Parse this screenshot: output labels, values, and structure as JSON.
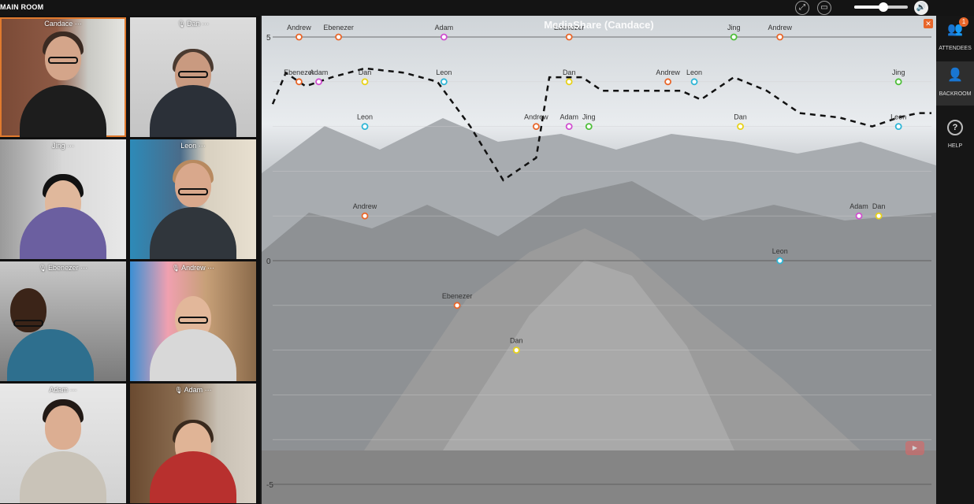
{
  "topbar": {
    "room_label": "MAIN ROOM",
    "volume_level": 0.55
  },
  "participants": [
    {
      "name": "Candace",
      "mic": false,
      "active": true
    },
    {
      "name": "Dan",
      "mic": true,
      "active": false
    },
    {
      "name": "Jing",
      "mic": false,
      "active": false
    },
    {
      "name": "Leon",
      "mic": false,
      "active": false
    },
    {
      "name": "Ebenezer",
      "mic": true,
      "active": false
    },
    {
      "name": "Andrew",
      "mic": true,
      "active": false
    },
    {
      "name": "Adam",
      "mic": false,
      "active": false
    },
    {
      "name": "Adam",
      "mic": true,
      "active": false
    }
  ],
  "tile_more": "···",
  "share": {
    "title": "MediaShare (Candace)"
  },
  "rightbar": {
    "attendees_label": "ATTENDEES",
    "attendees_badge": "1",
    "backroom_label": "BACKROOM",
    "help_label": "HELP"
  },
  "chart_data": {
    "type": "scatter",
    "ylim": [
      -5,
      5
    ],
    "y_ticks": [
      "5",
      "0",
      "-5"
    ],
    "grid": true,
    "colors": {
      "Ebenezer": "#e8662a",
      "Adam": "#d04fd0",
      "Dan": "#e8d21a",
      "Leon": "#2fb6d6",
      "Andrew": "#e8662a",
      "Jing": "#4fbf3a",
      "Candace": "#e8d21a"
    },
    "points": [
      {
        "label": "Andrew",
        "x": 0.04,
        "y": 5.0
      },
      {
        "label": "Ebenezer",
        "x": 0.1,
        "y": 5.0
      },
      {
        "label": "Adam",
        "x": 0.26,
        "y": 5.0
      },
      {
        "label": "Ebenezer",
        "x": 0.45,
        "y": 5.0
      },
      {
        "label": "Jing",
        "x": 0.7,
        "y": 5.0
      },
      {
        "label": "Andrew",
        "x": 0.77,
        "y": 5.0
      },
      {
        "label": "Ebenezer",
        "x": 0.04,
        "y": 4.0
      },
      {
        "label": "Adam",
        "x": 0.07,
        "y": 4.0
      },
      {
        "label": "Dan",
        "x": 0.14,
        "y": 4.0
      },
      {
        "label": "Leon",
        "x": 0.26,
        "y": 4.0
      },
      {
        "label": "Dan",
        "x": 0.45,
        "y": 4.0
      },
      {
        "label": "Andrew",
        "x": 0.6,
        "y": 4.0
      },
      {
        "label": "Leon",
        "x": 0.64,
        "y": 4.0
      },
      {
        "label": "Jing",
        "x": 0.95,
        "y": 4.0
      },
      {
        "label": "Leon",
        "x": 0.14,
        "y": 3.0
      },
      {
        "label": "Andrew",
        "x": 0.4,
        "y": 3.0
      },
      {
        "label": "Adam",
        "x": 0.45,
        "y": 3.0
      },
      {
        "label": "Jing",
        "x": 0.48,
        "y": 3.0
      },
      {
        "label": "Dan",
        "x": 0.71,
        "y": 3.0
      },
      {
        "label": "Leon",
        "x": 0.95,
        "y": 3.0
      },
      {
        "label": "Andrew",
        "x": 0.14,
        "y": 1.0
      },
      {
        "label": "Adam",
        "x": 0.89,
        "y": 1.0
      },
      {
        "label": "Dan",
        "x": 0.92,
        "y": 1.0
      },
      {
        "label": "Leon",
        "x": 0.77,
        "y": 0.0
      },
      {
        "label": "Ebenezer",
        "x": 0.28,
        "y": -1.0
      },
      {
        "label": "Dan",
        "x": 0.37,
        "y": -2.0
      }
    ],
    "trend_line": [
      [
        0.0,
        3.5
      ],
      [
        0.02,
        4.2
      ],
      [
        0.05,
        3.9
      ],
      [
        0.09,
        4.1
      ],
      [
        0.14,
        4.3
      ],
      [
        0.2,
        4.2
      ],
      [
        0.25,
        4.0
      ],
      [
        0.3,
        3.0
      ],
      [
        0.35,
        1.8
      ],
      [
        0.4,
        2.3
      ],
      [
        0.42,
        4.1
      ],
      [
        0.47,
        4.1
      ],
      [
        0.5,
        3.8
      ],
      [
        0.58,
        3.8
      ],
      [
        0.62,
        3.8
      ],
      [
        0.65,
        3.6
      ],
      [
        0.7,
        4.1
      ],
      [
        0.75,
        3.8
      ],
      [
        0.8,
        3.3
      ],
      [
        0.86,
        3.2
      ],
      [
        0.91,
        3.0
      ],
      [
        0.95,
        3.2
      ],
      [
        0.98,
        3.3
      ],
      [
        1.0,
        3.3
      ]
    ]
  }
}
